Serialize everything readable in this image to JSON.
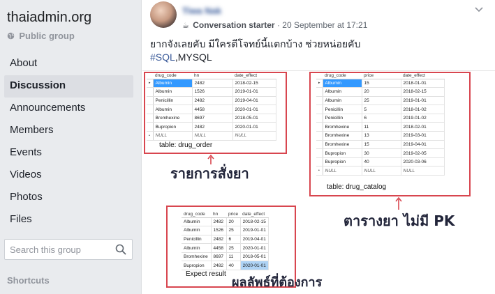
{
  "sidebar": {
    "group_name": "thaiadmin.org",
    "group_type": "Public group",
    "nav": [
      {
        "label": "About"
      },
      {
        "label": "Discussion",
        "active": true
      },
      {
        "label": "Announcements"
      },
      {
        "label": "Members"
      },
      {
        "label": "Events"
      },
      {
        "label": "Videos"
      },
      {
        "label": "Photos"
      },
      {
        "label": "Files"
      }
    ],
    "search_placeholder": "Search this group",
    "shortcuts": "Shortcuts"
  },
  "post": {
    "author": "Tiwa Nak",
    "badge": "Conversation starter",
    "separator": "·",
    "timestamp": "20 September at 17:21",
    "text_line1": "ยากจังเลยคับ มีใครตีโจทย์นี้แตกบ้าง ช่วยหน่อยคับ",
    "hashtag": "#SQL",
    "text_line2_rest": ",MYSQL",
    "image": {
      "drug_order": {
        "columns": [
          "drug_code",
          "hn",
          "date_effect"
        ],
        "rows": [
          [
            "Albumin",
            "2482",
            "2018-02-15"
          ],
          [
            "Albumin",
            "1526",
            "2019-01-01"
          ],
          [
            "Penicillin",
            "2482",
            "2019-04-01"
          ],
          [
            "Albumin",
            "4458",
            "2020-01-01"
          ],
          [
            "Bromhexine",
            "8697",
            "2018-05-01"
          ],
          [
            "Bupropion",
            "2482",
            "2020-01-01"
          ],
          [
            "NULL",
            "NULL",
            "NULL"
          ]
        ],
        "label": "table: drug_order",
        "caption": "รายการสั่งยา"
      },
      "drug_catalog": {
        "columns": [
          "drug_code",
          "price",
          "date_effect"
        ],
        "rows": [
          [
            "Albumin",
            "15",
            "2018-01-01"
          ],
          [
            "Albumin",
            "20",
            "2018-02-15"
          ],
          [
            "Albumin",
            "25",
            "2019-01-01"
          ],
          [
            "Penicillin",
            "5",
            "2018-01-02"
          ],
          [
            "Penicillin",
            "6",
            "2019-01-02"
          ],
          [
            "Bromhexine",
            "11",
            "2018-02-01"
          ],
          [
            "Bromhexine",
            "13",
            "2019-03-01"
          ],
          [
            "Bromhexine",
            "15",
            "2019-04-01"
          ],
          [
            "Bupropion",
            "30",
            "2019-02-05"
          ],
          [
            "Bupropion",
            "40",
            "2020-03-06"
          ],
          [
            "NULL",
            "NULL",
            "NULL"
          ]
        ],
        "label": "table: drug_catalog",
        "caption": "ตารางยา ไม่มี PK"
      },
      "expect": {
        "columns": [
          "drug_code",
          "hn",
          "price",
          "date_effect"
        ],
        "rows": [
          [
            "Albumin",
            "2482",
            "20",
            "2018-02-15"
          ],
          [
            "Albumin",
            "1526",
            "25",
            "2019-01-01"
          ],
          [
            "Penicillin",
            "2482",
            "6",
            "2019-04-01"
          ],
          [
            "Albumin",
            "4458",
            "25",
            "2020-01-01"
          ],
          [
            "Bromhexine",
            "8697",
            "11",
            "2018-05-01"
          ],
          [
            "Bupropion",
            "2482",
            "40",
            "2020-01-01"
          ]
        ],
        "label": "Expect result",
        "caption": "ผลลัพธ์ที่ต้องการ"
      }
    }
  },
  "colors": {
    "page_bg": "#e9ebee",
    "link": "#385898",
    "red_box": "#d8464f",
    "selection": "#3399ff"
  }
}
